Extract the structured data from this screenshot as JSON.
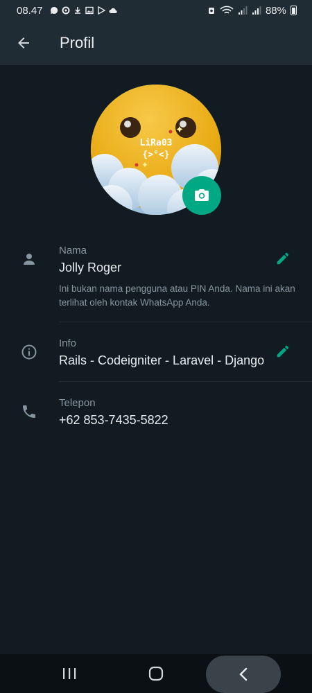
{
  "status_bar": {
    "time": "08.47",
    "battery": "88%",
    "left_icons": [
      "chat-bubble-icon",
      "settings-icon",
      "download-icon",
      "gallery-icon",
      "play-store-icon",
      "cloud-icon"
    ],
    "right_icons": [
      "alarm-icon",
      "wifi-icon",
      "signal-icon",
      "signal-icon"
    ]
  },
  "app_bar": {
    "title": "Profil"
  },
  "avatar": {
    "text_line1": "LiRa03",
    "text_line2": "{>°<}"
  },
  "profile": {
    "name": {
      "label": "Nama",
      "value": "Jolly Roger",
      "note": "Ini bukan nama pengguna atau PIN Anda. Nama ini akan terlihat oleh kontak WhatsApp Anda."
    },
    "info": {
      "label": "Info",
      "value": "Rails - Codeigniter - Laravel - Django"
    },
    "phone": {
      "label": "Telepon",
      "value": "+62 853-7435-5822"
    }
  },
  "colors": {
    "accent": "#00a884",
    "background": "#121b22",
    "app_bar": "#202c33",
    "secondary_text": "#8696a0"
  }
}
